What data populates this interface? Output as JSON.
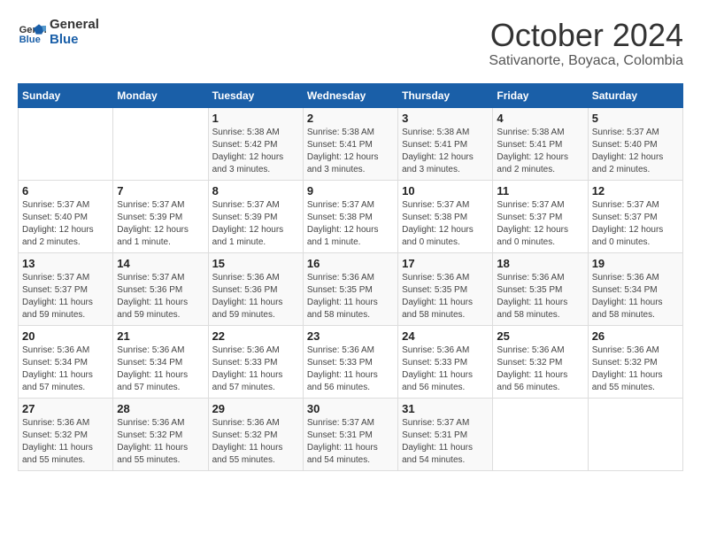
{
  "logo": {
    "line1": "General",
    "line2": "Blue"
  },
  "title": "October 2024",
  "subtitle": "Sativanorte, Boyaca, Colombia",
  "header_days": [
    "Sunday",
    "Monday",
    "Tuesday",
    "Wednesday",
    "Thursday",
    "Friday",
    "Saturday"
  ],
  "weeks": [
    [
      {
        "day": "",
        "info": ""
      },
      {
        "day": "",
        "info": ""
      },
      {
        "day": "1",
        "info": "Sunrise: 5:38 AM\nSunset: 5:42 PM\nDaylight: 12 hours and 3 minutes."
      },
      {
        "day": "2",
        "info": "Sunrise: 5:38 AM\nSunset: 5:41 PM\nDaylight: 12 hours and 3 minutes."
      },
      {
        "day": "3",
        "info": "Sunrise: 5:38 AM\nSunset: 5:41 PM\nDaylight: 12 hours and 3 minutes."
      },
      {
        "day": "4",
        "info": "Sunrise: 5:38 AM\nSunset: 5:41 PM\nDaylight: 12 hours and 2 minutes."
      },
      {
        "day": "5",
        "info": "Sunrise: 5:37 AM\nSunset: 5:40 PM\nDaylight: 12 hours and 2 minutes."
      }
    ],
    [
      {
        "day": "6",
        "info": "Sunrise: 5:37 AM\nSunset: 5:40 PM\nDaylight: 12 hours and 2 minutes."
      },
      {
        "day": "7",
        "info": "Sunrise: 5:37 AM\nSunset: 5:39 PM\nDaylight: 12 hours and 1 minute."
      },
      {
        "day": "8",
        "info": "Sunrise: 5:37 AM\nSunset: 5:39 PM\nDaylight: 12 hours and 1 minute."
      },
      {
        "day": "9",
        "info": "Sunrise: 5:37 AM\nSunset: 5:38 PM\nDaylight: 12 hours and 1 minute."
      },
      {
        "day": "10",
        "info": "Sunrise: 5:37 AM\nSunset: 5:38 PM\nDaylight: 12 hours and 0 minutes."
      },
      {
        "day": "11",
        "info": "Sunrise: 5:37 AM\nSunset: 5:37 PM\nDaylight: 12 hours and 0 minutes."
      },
      {
        "day": "12",
        "info": "Sunrise: 5:37 AM\nSunset: 5:37 PM\nDaylight: 12 hours and 0 minutes."
      }
    ],
    [
      {
        "day": "13",
        "info": "Sunrise: 5:37 AM\nSunset: 5:37 PM\nDaylight: 11 hours and 59 minutes."
      },
      {
        "day": "14",
        "info": "Sunrise: 5:37 AM\nSunset: 5:36 PM\nDaylight: 11 hours and 59 minutes."
      },
      {
        "day": "15",
        "info": "Sunrise: 5:36 AM\nSunset: 5:36 PM\nDaylight: 11 hours and 59 minutes."
      },
      {
        "day": "16",
        "info": "Sunrise: 5:36 AM\nSunset: 5:35 PM\nDaylight: 11 hours and 58 minutes."
      },
      {
        "day": "17",
        "info": "Sunrise: 5:36 AM\nSunset: 5:35 PM\nDaylight: 11 hours and 58 minutes."
      },
      {
        "day": "18",
        "info": "Sunrise: 5:36 AM\nSunset: 5:35 PM\nDaylight: 11 hours and 58 minutes."
      },
      {
        "day": "19",
        "info": "Sunrise: 5:36 AM\nSunset: 5:34 PM\nDaylight: 11 hours and 58 minutes."
      }
    ],
    [
      {
        "day": "20",
        "info": "Sunrise: 5:36 AM\nSunset: 5:34 PM\nDaylight: 11 hours and 57 minutes."
      },
      {
        "day": "21",
        "info": "Sunrise: 5:36 AM\nSunset: 5:34 PM\nDaylight: 11 hours and 57 minutes."
      },
      {
        "day": "22",
        "info": "Sunrise: 5:36 AM\nSunset: 5:33 PM\nDaylight: 11 hours and 57 minutes."
      },
      {
        "day": "23",
        "info": "Sunrise: 5:36 AM\nSunset: 5:33 PM\nDaylight: 11 hours and 56 minutes."
      },
      {
        "day": "24",
        "info": "Sunrise: 5:36 AM\nSunset: 5:33 PM\nDaylight: 11 hours and 56 minutes."
      },
      {
        "day": "25",
        "info": "Sunrise: 5:36 AM\nSunset: 5:32 PM\nDaylight: 11 hours and 56 minutes."
      },
      {
        "day": "26",
        "info": "Sunrise: 5:36 AM\nSunset: 5:32 PM\nDaylight: 11 hours and 55 minutes."
      }
    ],
    [
      {
        "day": "27",
        "info": "Sunrise: 5:36 AM\nSunset: 5:32 PM\nDaylight: 11 hours and 55 minutes."
      },
      {
        "day": "28",
        "info": "Sunrise: 5:36 AM\nSunset: 5:32 PM\nDaylight: 11 hours and 55 minutes."
      },
      {
        "day": "29",
        "info": "Sunrise: 5:36 AM\nSunset: 5:32 PM\nDaylight: 11 hours and 55 minutes."
      },
      {
        "day": "30",
        "info": "Sunrise: 5:37 AM\nSunset: 5:31 PM\nDaylight: 11 hours and 54 minutes."
      },
      {
        "day": "31",
        "info": "Sunrise: 5:37 AM\nSunset: 5:31 PM\nDaylight: 11 hours and 54 minutes."
      },
      {
        "day": "",
        "info": ""
      },
      {
        "day": "",
        "info": ""
      }
    ]
  ]
}
